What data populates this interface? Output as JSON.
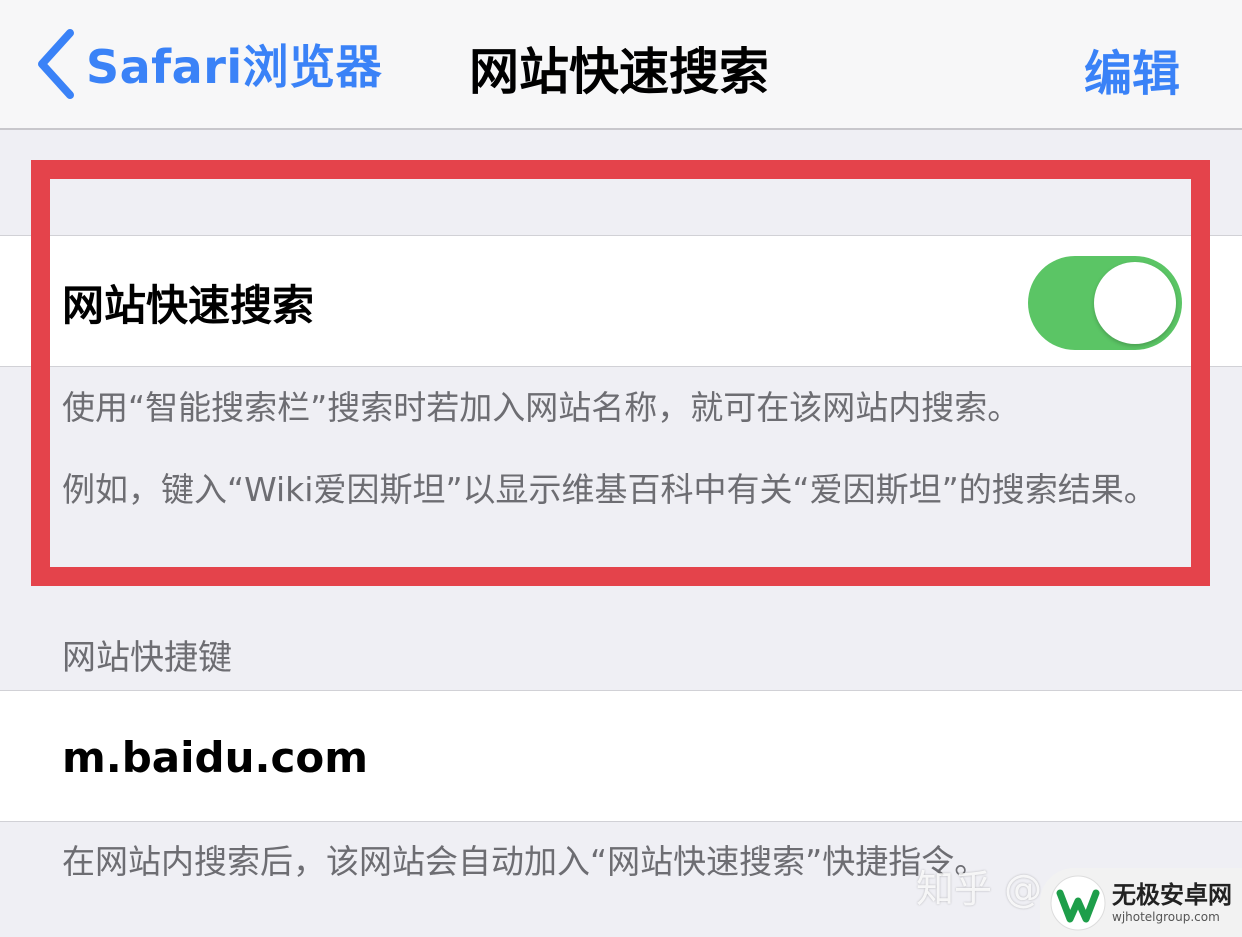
{
  "navbar": {
    "back_label": "Safari浏览器",
    "title": "网站快速搜索",
    "edit_label": "编辑"
  },
  "quick_search": {
    "label": "网站快速搜索",
    "enabled": true,
    "description_1": "使用“智能搜索栏”搜索时若加入网站名称，就可在该网站内搜索。",
    "description_2": "例如，键入“Wiki爱因斯坦”以显示维基百科中有关“爱因斯坦”的搜索结果。"
  },
  "shortcuts": {
    "header": "网站快捷键",
    "items": [
      "m.baidu.com"
    ],
    "footer": "在网站内搜索后，该网站会自动加入“网站快速搜索”快捷指令。"
  },
  "watermarks": {
    "zhihu": "知乎 @",
    "site_name": "无极安卓网",
    "site_url": "wjhotelgroup.com"
  },
  "colors": {
    "accent": "#3a82f7",
    "toggle_on": "#5bc565",
    "highlight": "#e4434b"
  }
}
